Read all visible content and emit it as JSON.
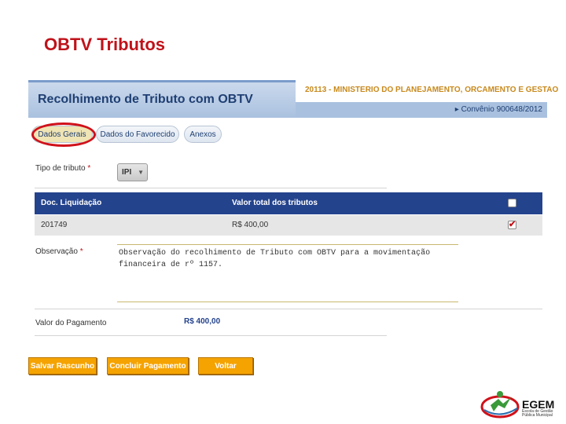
{
  "slide_title": "OBTV Tributos",
  "header": {
    "title": "Recolhimento de Tributo com OBTV",
    "ministry": "20113 - MINISTERIO DO PLANEJAMENTO, ORCAMENTO E GESTAO",
    "convenio": "Convênio 900648/2012"
  },
  "tabs": [
    {
      "label": "Dados Gerais",
      "active": true
    },
    {
      "label": "Dados do Favorecido",
      "active": false
    },
    {
      "label": "Anexos",
      "active": false
    }
  ],
  "form": {
    "tipo_label": "Tipo de tributo",
    "required_mark": "*",
    "tipo_value": "IPI",
    "table": {
      "headers": [
        "Doc. Liquidação",
        "Valor total dos tributos"
      ],
      "rows": [
        {
          "doc": "201749",
          "valor": "R$ 400,00",
          "checked": true
        }
      ]
    },
    "obs_label": "Observação",
    "obs_value": "Observação do recolhimento de Tributo com OBTV para a movimentação\nfinanceira de rº 1157.",
    "payment_label": "Valor do Pagamento",
    "payment_value": "R$ 400,00"
  },
  "buttons": {
    "salvar": "Salvar Rascunho",
    "concluir": "Concluir Pagamento",
    "voltar": "Voltar"
  },
  "logo": {
    "name": "EGEM",
    "subtitle": "Escola de Gestão Pública Municipal"
  },
  "colors": {
    "accent_red": "#c0121a",
    "header_blue": "#24438d",
    "button_orange": "#f5a300"
  }
}
